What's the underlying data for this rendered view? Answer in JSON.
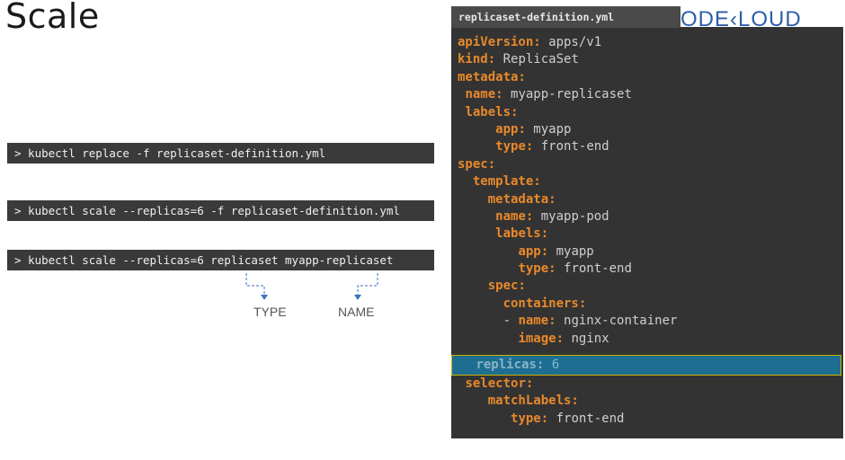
{
  "slide": {
    "title": "Scale",
    "logo_text": "ODE‹LOUD"
  },
  "commands": [
    "> kubectl replace -f replicaset-definition.yml",
    "> kubectl scale --replicas=6 -f replicaset-definition.yml",
    "> kubectl scale --replicas=6 replicaset myapp-replicaset"
  ],
  "annotations": {
    "type_label": "TYPE",
    "name_label": "NAME"
  },
  "editor": {
    "tab_label": "replicaset-definition.yml",
    "lines": [
      {
        "indent": "",
        "key": "apiVersion:",
        "value": " apps/v1"
      },
      {
        "indent": "",
        "key": "kind:",
        "value": " ReplicaSet"
      },
      {
        "indent": "",
        "key": "metadata:",
        "value": ""
      },
      {
        "indent": " ",
        "key": "name:",
        "value": " myapp-replicaset"
      },
      {
        "indent": " ",
        "key": "labels:",
        "value": ""
      },
      {
        "indent": "     ",
        "key": "app:",
        "value": " myapp"
      },
      {
        "indent": "     ",
        "key": "type:",
        "value": " front-end"
      },
      {
        "indent": "",
        "key": "spec:",
        "value": ""
      },
      {
        "indent": "  ",
        "key": "template:",
        "value": ""
      },
      {
        "indent": "    ",
        "key": "metadata:",
        "value": ""
      },
      {
        "indent": "     ",
        "key": "name:",
        "value": " myapp-pod"
      },
      {
        "indent": "     ",
        "key": "labels:",
        "value": ""
      },
      {
        "indent": "        ",
        "key": "app:",
        "value": " myapp"
      },
      {
        "indent": "        ",
        "key": "type:",
        "value": " front-end"
      },
      {
        "indent": "    ",
        "key": "spec:",
        "value": ""
      },
      {
        "indent": "      ",
        "key": "containers:",
        "value": ""
      },
      {
        "indent": "      - ",
        "key": "name:",
        "value": " nginx-container"
      },
      {
        "indent": "        ",
        "key": "image:",
        "value": " nginx"
      }
    ],
    "highlighted_line": {
      "indent": " ",
      "key": "replicas:",
      "value": " 6"
    },
    "tail_lines": [
      {
        "indent": " ",
        "key": "selector:",
        "value": ""
      },
      {
        "indent": "    ",
        "key": "matchLabels:",
        "value": ""
      },
      {
        "indent": "       ",
        "key": "type:",
        "value": " front-end"
      }
    ]
  },
  "colors": {
    "yaml_key": "#e8892b",
    "highlight_bg": "#1d6e91",
    "command_bg": "#3a3a3a",
    "editor_bg": "#333333"
  }
}
